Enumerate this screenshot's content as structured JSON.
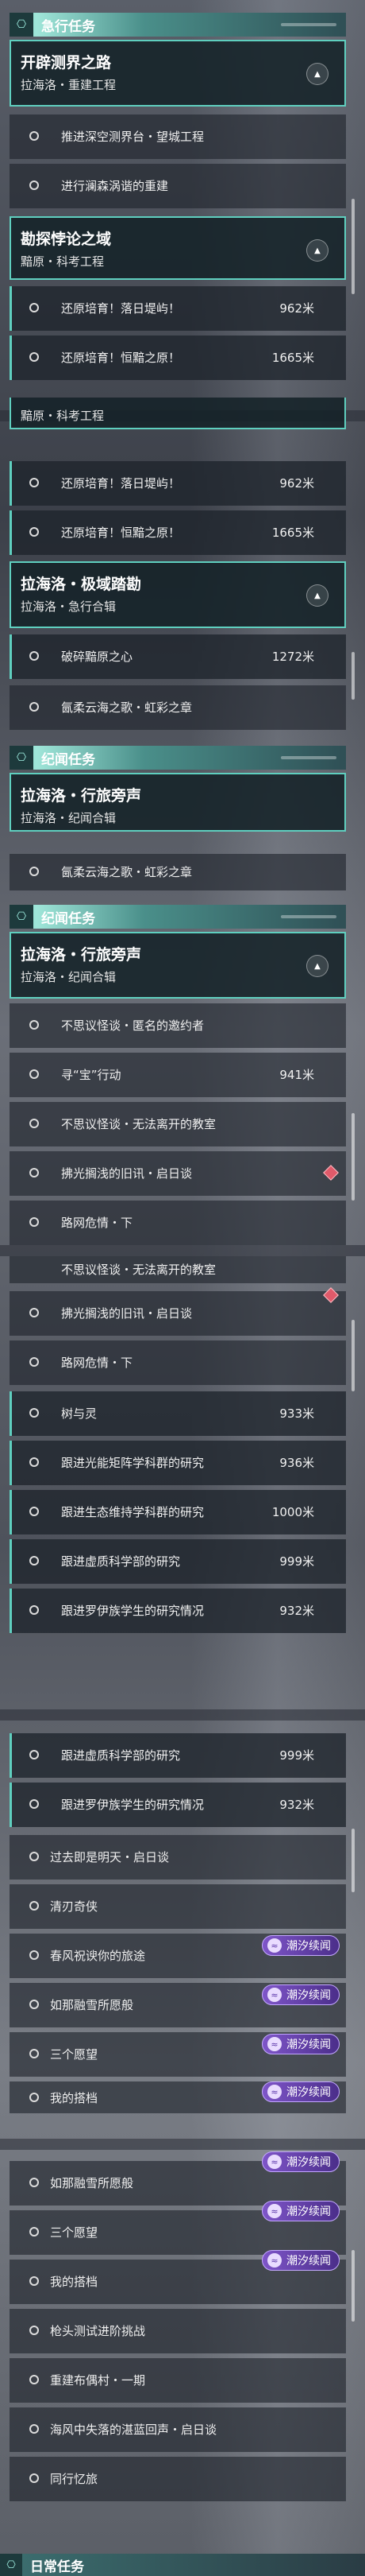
{
  "categories": {
    "urgent": {
      "label": "急行任务"
    },
    "side": {
      "label": "纪闻任务"
    },
    "daily": {
      "label": "日常任务"
    }
  },
  "groups": {
    "g1": {
      "title": "开辟测界之路",
      "subtitle": "拉海洛・重建工程"
    },
    "g2": {
      "title": "勘探悖论之域",
      "subtitle": "黯原・科考工程"
    },
    "g2b": {
      "title": "拉海洛・极域踏勘",
      "subtitle": "黯原・科考工程"
    },
    "g3": {
      "title": "拉海洛・极域踏勘",
      "subtitle": "拉海洛・急行合辑"
    },
    "g4": {
      "title": "拉海洛・行旅旁声",
      "subtitle": "拉海洛・纪闻合辑"
    },
    "g5": {
      "title": "拉海洛・行旅旁声",
      "subtitle": "拉海洛・纪闻合辑"
    }
  },
  "rows": {
    "r1": {
      "text": "推进深空测界台・望城工程",
      "dist": ""
    },
    "r2": {
      "text": "进行澜森涡谐的重建",
      "dist": ""
    },
    "r3": {
      "text": "还原培育！落日堤屿！",
      "dist": "962米"
    },
    "r4": {
      "text": "还原培育！恒黯之原！",
      "dist": "1665米"
    },
    "r5": {
      "text": "还原培育！落日堤屿！",
      "dist": "962米"
    },
    "r6": {
      "text": "还原培育！恒黯之原！",
      "dist": "1665米"
    },
    "r7": {
      "text": "破碎黯原之心",
      "dist": "1272米"
    },
    "r8": {
      "text": "氤柔云海之歌・虹彩之章",
      "dist": ""
    },
    "r9": {
      "text": "氤柔云海之歌・虹彩之章",
      "dist": ""
    },
    "r10": {
      "text": "不思议怪谈・匿名的邀约者",
      "dist": ""
    },
    "r11": {
      "text": "寻“宝”行动",
      "dist": "941米"
    },
    "r12": {
      "text": "不思议怪谈・无法离开的教室",
      "dist": ""
    },
    "r13": {
      "text": "拂光搁浅的旧讯・启日谈",
      "dist": ""
    },
    "r14": {
      "text": "路网危情・下",
      "dist": ""
    },
    "r15": {
      "text": "不思议怪谈・无法离开的教室",
      "dist": ""
    },
    "r16": {
      "text": "拂光搁浅的旧讯・启日谈",
      "dist": ""
    },
    "r17": {
      "text": "路网危情・下",
      "dist": ""
    },
    "r18": {
      "text": "树与灵",
      "dist": "933米"
    },
    "r19": {
      "text": "跟进光能矩阵学科群的研究",
      "dist": "936米"
    },
    "r20": {
      "text": "跟进生态维持学科群的研究",
      "dist": "1000米"
    },
    "r21": {
      "text": "跟进虚质科学部的研究",
      "dist": "999米"
    },
    "r22": {
      "text": "跟进罗伊族学生的研究情况",
      "dist": "932米"
    },
    "r23": {
      "text": "跟进虚质科学部的研究",
      "dist": "999米"
    },
    "r24": {
      "text": "跟进罗伊族学生的研究情况",
      "dist": "932米"
    },
    "r25": {
      "text": "过去即是明天・启日谈",
      "dist": ""
    },
    "r26": {
      "text": "清刃奇侠",
      "dist": ""
    },
    "r27": {
      "text": "春风祝谀你的旅途",
      "dist": ""
    },
    "r28": {
      "text": "如那融雪所愿般",
      "dist": ""
    },
    "r29": {
      "text": "三个愿望",
      "dist": ""
    },
    "r30": {
      "text": "我的搭档",
      "dist": ""
    },
    "r31": {
      "text": "如那融雪所愿般",
      "dist": ""
    },
    "r32": {
      "text": "三个愿望",
      "dist": ""
    },
    "r33": {
      "text": "我的搭档",
      "dist": ""
    },
    "r34": {
      "text": "枪头测试进阶挑战",
      "dist": ""
    },
    "r35": {
      "text": "重建布偶村・一期",
      "dist": ""
    },
    "r36": {
      "text": "海风中失落的湛蓝回声・启日谈",
      "dist": ""
    },
    "r37": {
      "text": "同行忆旅",
      "dist": ""
    }
  },
  "badge": {
    "label": "潮汐续闻"
  },
  "icons": {
    "category": "map-icon",
    "toggle": "chevron-up-icon",
    "row": "circle-icon",
    "badge": "tide-icon",
    "marker": "diamond-icon"
  },
  "colors": {
    "accent": "#5fcfbf",
    "badge": "#7e55c8",
    "marker": "#e05a6a"
  }
}
